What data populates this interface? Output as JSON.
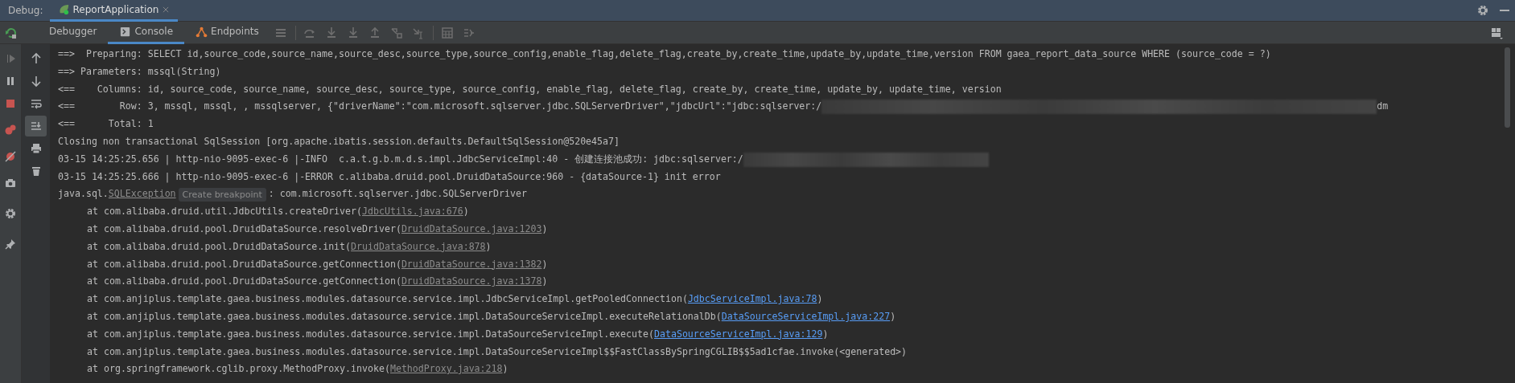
{
  "title_bar": {
    "label": "Debug:",
    "tabs": [
      {
        "label": "ReportApplication",
        "selected": true
      }
    ]
  },
  "tool_tabs": [
    {
      "label": "Debugger",
      "selected": false
    },
    {
      "label": "Console",
      "selected": true
    },
    {
      "label": "Endpoints",
      "selected": false
    }
  ],
  "console": {
    "lines": [
      {
        "kind": "log",
        "segments": [
          {
            "kind": "text",
            "text": "==>  Preparing: SELECT id,source_code,source_name,source_desc,source_type,source_config,enable_flag,delete_flag,create_by,create_time,update_by,update_time,version FROM gaea_report_data_source WHERE (source_code = ?)"
          }
        ]
      },
      {
        "kind": "log",
        "segments": [
          {
            "kind": "text",
            "text": "==> Parameters: mssql(String)"
          }
        ]
      },
      {
        "kind": "log",
        "segments": [
          {
            "kind": "text",
            "text": "<==    Columns: id, source_code, source_name, source_desc, source_type, source_config, enable_flag, delete_flag, create_by, create_time, update_by, update_time, version"
          }
        ]
      },
      {
        "kind": "log",
        "segments": [
          {
            "kind": "text",
            "text": "<==        Row: 3, mssql, mssql, , mssqlserver, {\"driverName\":\"com.microsoft.sqlserver.jdbc.SQLServerDriver\",\"jdbcUrl\":\"jdbc:sqlserver:/"
          },
          {
            "kind": "redacted"
          },
          {
            "kind": "text",
            "text": "dm"
          }
        ]
      },
      {
        "kind": "log",
        "segments": [
          {
            "kind": "text",
            "text": "<==      Total: 1"
          }
        ]
      },
      {
        "kind": "log",
        "segments": [
          {
            "kind": "text",
            "text": "Closing non transactional SqlSession [org.apache.ibatis.session.defaults.DefaultSqlSession@520e45a7]"
          }
        ]
      },
      {
        "kind": "log",
        "segments": [
          {
            "kind": "text",
            "text": "03-15 14:25:25.656 | http-nio-9095-exec-6 |-INFO  c.a.t.g.b.m.d.s.impl.JdbcServiceImpl:40 - 创建连接池成功: jdbc:sqlserver:/"
          },
          {
            "kind": "redacted"
          }
        ]
      },
      {
        "kind": "log",
        "segments": [
          {
            "kind": "text",
            "text": "03-15 14:25:25.666 | http-nio-9095-exec-6 |-ERROR c.alibaba.druid.pool.DruidDataSource:960 - {dataSource-1} init error"
          }
        ]
      },
      {
        "kind": "log",
        "segments": [
          {
            "kind": "text",
            "text": "java.sql."
          },
          {
            "kind": "library_link",
            "text": "SQLException"
          },
          {
            "kind": "hint",
            "text": "Create breakpoint"
          },
          {
            "kind": "text",
            "text": ": com.microsoft.sqlserver.jdbc.SQLServerDriver"
          }
        ]
      },
      {
        "kind": "frame",
        "segments": [
          {
            "kind": "text",
            "text": "at com.alibaba.druid.util.JdbcUtils.createDriver("
          },
          {
            "kind": "library_link",
            "text": "JdbcUtils.java:676"
          },
          {
            "kind": "text",
            "text": ")"
          }
        ]
      },
      {
        "kind": "frame",
        "segments": [
          {
            "kind": "text",
            "text": "at com.alibaba.druid.pool.DruidDataSource.resolveDriver("
          },
          {
            "kind": "library_link",
            "text": "DruidDataSource.java:1203"
          },
          {
            "kind": "text",
            "text": ")"
          }
        ]
      },
      {
        "kind": "frame",
        "segments": [
          {
            "kind": "text",
            "text": "at com.alibaba.druid.pool.DruidDataSource.init("
          },
          {
            "kind": "library_link",
            "text": "DruidDataSource.java:878"
          },
          {
            "kind": "text",
            "text": ")"
          }
        ]
      },
      {
        "kind": "frame",
        "segments": [
          {
            "kind": "text",
            "text": "at com.alibaba.druid.pool.DruidDataSource.getConnection("
          },
          {
            "kind": "library_link",
            "text": "DruidDataSource.java:1382"
          },
          {
            "kind": "text",
            "text": ")"
          }
        ]
      },
      {
        "kind": "frame",
        "segments": [
          {
            "kind": "text",
            "text": "at com.alibaba.druid.pool.DruidDataSource.getConnection("
          },
          {
            "kind": "library_link",
            "text": "DruidDataSource.java:1378"
          },
          {
            "kind": "text",
            "text": ")"
          }
        ]
      },
      {
        "kind": "frame",
        "segments": [
          {
            "kind": "text",
            "text": "at com.anjiplus.template.gaea.business.modules.datasource.service.impl.JdbcServiceImpl.getPooledConnection("
          },
          {
            "kind": "project_link",
            "text": "JdbcServiceImpl.java:78"
          },
          {
            "kind": "text",
            "text": ")"
          }
        ]
      },
      {
        "kind": "frame",
        "segments": [
          {
            "kind": "text",
            "text": "at com.anjiplus.template.gaea.business.modules.datasource.service.impl.DataSourceServiceImpl.executeRelationalDb("
          },
          {
            "kind": "project_link",
            "text": "DataSourceServiceImpl.java:227"
          },
          {
            "kind": "text",
            "text": ")"
          }
        ]
      },
      {
        "kind": "frame",
        "segments": [
          {
            "kind": "text",
            "text": "at com.anjiplus.template.gaea.business.modules.datasource.service.impl.DataSourceServiceImpl.execute("
          },
          {
            "kind": "project_link",
            "text": "DataSourceServiceImpl.java:129"
          },
          {
            "kind": "text",
            "text": ")"
          }
        ]
      },
      {
        "kind": "frame",
        "segments": [
          {
            "kind": "text",
            "text": "at com.anjiplus.template.gaea.business.modules.datasource.service.impl.DataSourceServiceImpl$$FastClassBySpringCGLIB$$5ad1cfae.invoke(<generated>)"
          }
        ]
      },
      {
        "kind": "frame",
        "segments": [
          {
            "kind": "text",
            "text": "at org.springframework.cglib.proxy.MethodProxy.invoke("
          },
          {
            "kind": "library_link",
            "text": "MethodProxy.java:218"
          },
          {
            "kind": "text",
            "text": ")"
          }
        ]
      }
    ]
  }
}
